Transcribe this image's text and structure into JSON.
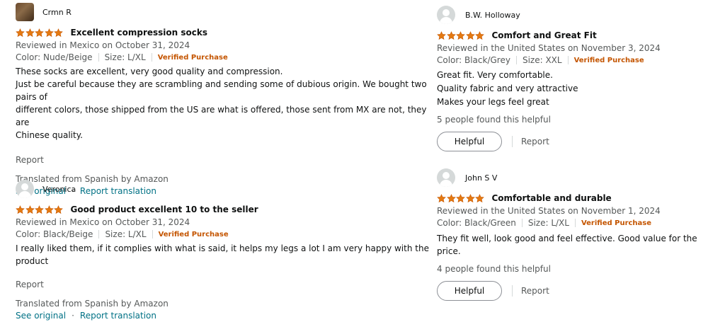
{
  "colors": {
    "star": "#e47911",
    "verified": "#c45500",
    "link": "#007185",
    "muted": "#565959"
  },
  "left_reviews": [
    {
      "author": "Crmn R",
      "rating": 5,
      "title": "Excellent compression socks",
      "reviewed": "Reviewed in Mexico on October 31, 2024",
      "color": "Color: Nude/Beige",
      "size": "Size: L/XL",
      "verified": "Verified Purchase",
      "body_lines": [
        "These socks are excellent, very good quality and compression.",
        "Just be careful because they are scrambling and sending some of dubious origin. We bought two pairs of",
        "different colors, those shipped from the US are what is offered, those sent from MX are not, they are",
        "Chinese quality."
      ],
      "report": "Report",
      "translated": "Translated from Spanish by Amazon",
      "see_original": "See original",
      "report_translation": "Report translation"
    },
    {
      "author": "Veronica",
      "rating": 5,
      "title": "Good product excellent 10 to the seller",
      "reviewed": "Reviewed in Mexico on October 31, 2024",
      "color": "Color: Black/Beige",
      "size": "Size: L/XL",
      "verified": "Verified Purchase",
      "body_lines": [
        "I really liked them, if it complies with what is said, it helps my legs a lot I am very happy with the product"
      ],
      "report": "Report",
      "translated": "Translated from Spanish by Amazon",
      "see_original": "See original",
      "report_translation": "Report translation"
    }
  ],
  "right_reviews": [
    {
      "author": "B.W. Holloway",
      "rating": 5,
      "title": "Comfort and Great Fit",
      "reviewed": "Reviewed in the United States on November 3, 2024",
      "color": "Color: Black/Grey",
      "size": "Size: XXL",
      "verified": "Verified Purchase",
      "body_lines": [
        "Great fit. Very comfortable.",
        "Quality fabric and very attractive",
        "Makes your legs feel great"
      ],
      "helpful_count": "5 people found this helpful",
      "helpful_label": "Helpful",
      "report": "Report"
    },
    {
      "author": "John S V",
      "rating": 5,
      "title": "Comfortable and durable",
      "reviewed": "Reviewed in the United States on November 1, 2024",
      "color": "Color: Black/Green",
      "size": "Size: L/XL",
      "verified": "Verified Purchase",
      "body_lines": [
        "They fit well, look good and feel effective. Good value for the price."
      ],
      "helpful_count": "4 people found this helpful",
      "helpful_label": "Helpful",
      "report": "Report"
    }
  ]
}
